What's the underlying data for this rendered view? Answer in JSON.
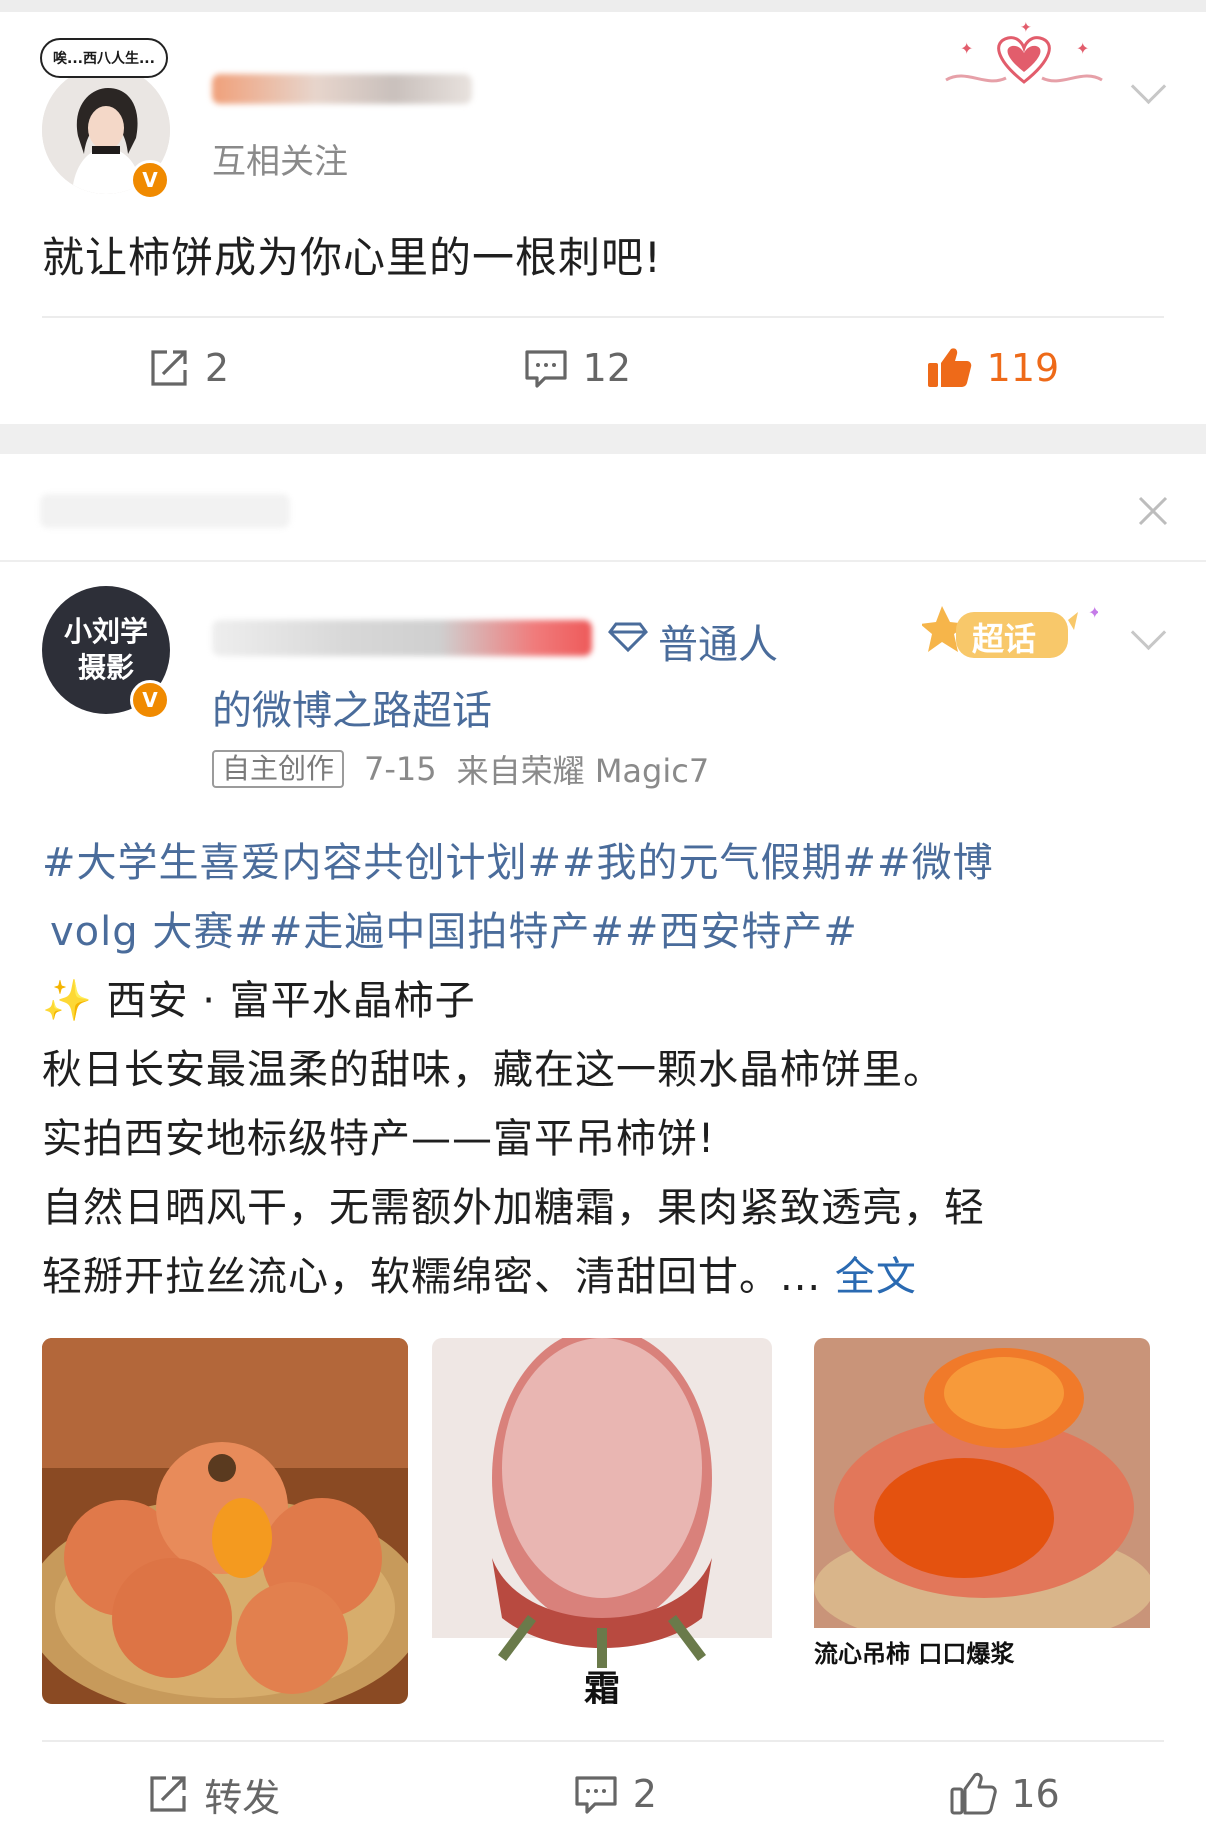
{
  "post1": {
    "avatar_bubble": "唉...西八人生...",
    "relation": "互相关注",
    "text": "就让柿饼成为你心里的一根刺吧!",
    "actions": {
      "repost_count": "2",
      "comment_count": "12",
      "like_count": "119"
    }
  },
  "post2": {
    "avatar_text": "小刘学摄影",
    "name_suffix": "普通人",
    "name_line2": "的微博之路超话",
    "super_topic_badge": "超话",
    "tag": "自主创作",
    "date": "7-15",
    "source": "来自荣耀 Magic7",
    "hashtags_line1": "#大学生喜爱内容共创计划##我的元气假期##微博",
    "hashtags_line2": "volg 大赛##走遍中国拍特产##西安特产#",
    "sparkle": "✨",
    "title_line": "西安 · 富平水晶柿子",
    "body_lines": [
      "秋日长安最温柔的甜味，藏在这一颗水晶柿饼里。",
      "实拍西安地标级特产——富平吊柿饼!",
      "自然日晒风干，无需额外加糖霜，果肉紧致透亮，轻",
      "轻掰开拉丝流心，软糯绵密、清甜回甘。..."
    ],
    "more_link": "全文",
    "images": [
      {
        "caption": ""
      },
      {
        "caption": "霜"
      },
      {
        "caption": "流心吊柿 口口爆浆"
      }
    ],
    "actions": {
      "repost_label": "转发",
      "comment_count": "2",
      "like_count": "16"
    }
  },
  "colors": {
    "accent_orange": "#ee6a19",
    "hashtag_blue": "#4a6c9b",
    "link_blue": "#2a6ab2",
    "separator": "#efefef"
  }
}
